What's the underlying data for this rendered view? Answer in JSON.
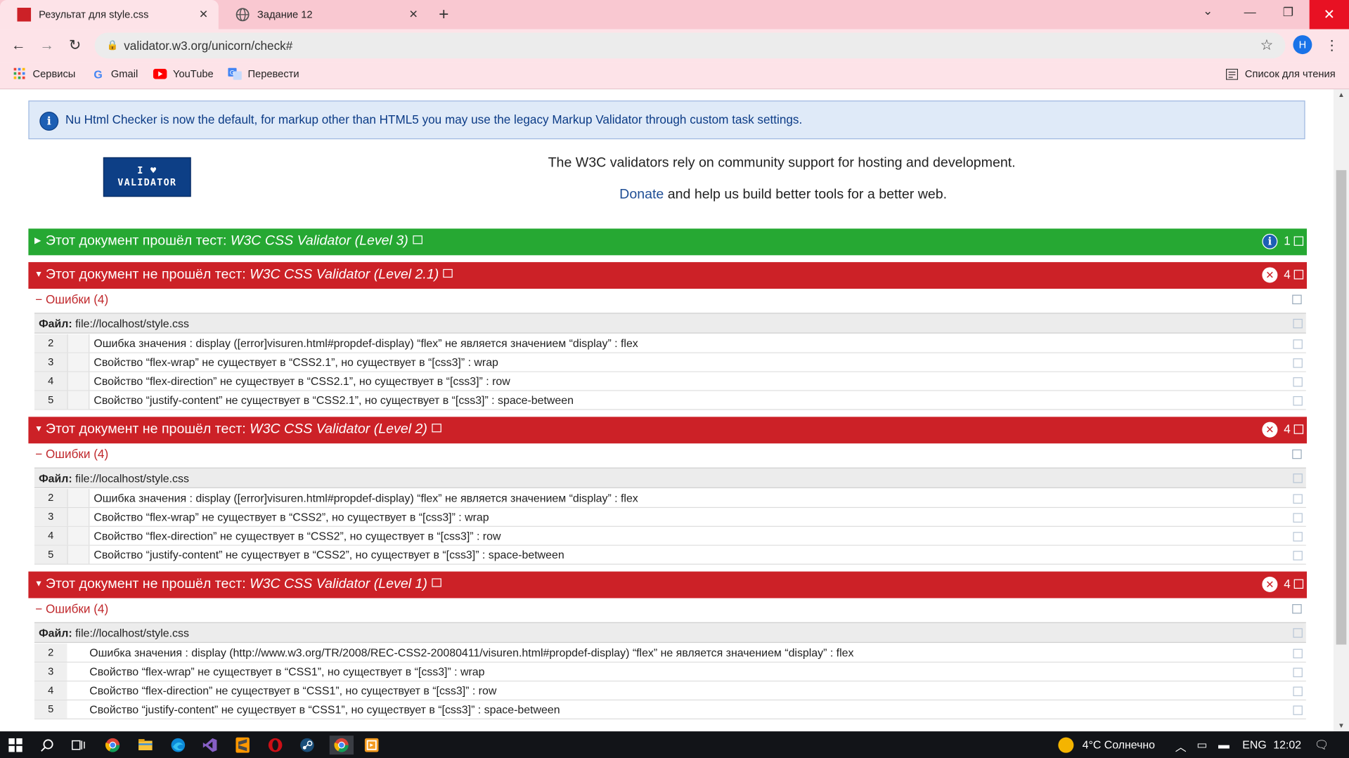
{
  "browser": {
    "tabs": [
      {
        "title": "Результат для style.css",
        "active": true,
        "close": "✕"
      },
      {
        "title": "Задание 12",
        "active": false,
        "close": "✕"
      }
    ],
    "new_tab": "+",
    "window_controls": {
      "minimize": "—",
      "restore": "❐",
      "close": "✕",
      "dropdown": "⌄"
    },
    "nav": {
      "back": "←",
      "forward": "→",
      "reload": "↻"
    },
    "url": "validator.w3.org/unicorn/check#",
    "profile_initial": "H",
    "bookmarks": [
      {
        "label": "Сервисы",
        "icon": "apps-grid-icon"
      },
      {
        "label": "Gmail",
        "icon": "google-g-icon"
      },
      {
        "label": "YouTube",
        "icon": "youtube-icon"
      },
      {
        "label": "Перевести",
        "icon": "translate-icon"
      }
    ],
    "reading_list": "Список для чтения",
    "colors": {
      "tab_strip": "#f9c8d1",
      "toolbar": "#fde3e8",
      "close_hover": "#e81123"
    }
  },
  "page": {
    "info_text": "Nu Html Checker is now the default, for markup other than HTML5 you may use the legacy Markup Validator through custom task settings.",
    "logo_lines": [
      "I ♥",
      "VALIDATOR"
    ],
    "support_line1": "The W3C validators rely on community support for hosting and development.",
    "donate_link": "Donate",
    "support_line2_rest": " and help us build better tools for a better web.",
    "colors": {
      "pass": "#26a833",
      "fail": "#cc2127",
      "info_bg": "#dfeaf8",
      "link": "#1f4e95"
    },
    "sections": [
      {
        "status": "pass",
        "prefix": "Этот документ прошёл тест: ",
        "validator": "W3C CSS Validator (Level 3)",
        "count": "1",
        "status_icon": "info-icon"
      },
      {
        "status": "fail",
        "prefix": "Этот документ не прошёл тест: ",
        "validator": "W3C CSS Validator (Level 2.1)",
        "count": "4",
        "status_icon": "error-icon",
        "errors_label": "− Ошибки (4)",
        "file_label": "Файл:",
        "file_path": " file://localhost/style.css",
        "rows": [
          {
            "line": "2",
            "message": "Ошибка значения : display ([error]visuren.html#propdef-display) “flex” не является значением “display” : flex"
          },
          {
            "line": "3",
            "message": "Свойство “flex-wrap” не существует в “CSS2.1”, но существует в “[css3]” : wrap"
          },
          {
            "line": "4",
            "message": "Свойство “flex-direction” не существует в “CSS2.1”, но существует в “[css3]” : row"
          },
          {
            "line": "5",
            "message": "Свойство “justify-content” не существует в “CSS2.1”, но существует в “[css3]” : space-between"
          }
        ]
      },
      {
        "status": "fail",
        "prefix": "Этот документ не прошёл тест: ",
        "validator": "W3C CSS Validator (Level 2)",
        "count": "4",
        "status_icon": "error-icon",
        "errors_label": "− Ошибки (4)",
        "file_label": "Файл:",
        "file_path": " file://localhost/style.css",
        "rows": [
          {
            "line": "2",
            "message": "Ошибка значения : display ([error]visuren.html#propdef-display) “flex” не является значением “display” : flex"
          },
          {
            "line": "3",
            "message": "Свойство “flex-wrap” не существует в “CSS2”, но существует в “[css3]” : wrap"
          },
          {
            "line": "4",
            "message": "Свойство “flex-direction” не существует в “CSS2”, но существует в “[css3]” : row"
          },
          {
            "line": "5",
            "message": "Свойство “justify-content” не существует в “CSS2”, но существует в “[css3]” : space-between"
          }
        ]
      },
      {
        "status": "fail",
        "prefix": "Этот документ не прошёл тест: ",
        "validator": "W3C CSS Validator (Level 1)",
        "count": "4",
        "status_icon": "error-icon",
        "errors_label": "− Ошибки (4)",
        "file_label": "Файл:",
        "file_path": " file://localhost/style.css",
        "rows": [
          {
            "line": "2",
            "message": "Ошибка значения : display (http://www.w3.org/TR/2008/REC-CSS2-20080411/visuren.html#propdef-display) “flex” не является значением “display” : flex"
          },
          {
            "line": "3",
            "message": "Свойство “flex-wrap” не существует в “CSS1”, но существует в “[css3]” : wrap"
          },
          {
            "line": "4",
            "message": "Свойство “flex-direction” не существует в “CSS1”, но существует в “[css3]” : row"
          },
          {
            "line": "5",
            "message": "Свойство “justify-content” не существует в “CSS1”, но существует в “[css3]” : space-between"
          }
        ]
      }
    ]
  },
  "taskbar": {
    "apps": [
      "windows-start-icon",
      "search-icon",
      "task-view-icon",
      "chrome-icon",
      "file-explorer-icon",
      "edge-icon",
      "visual-studio-icon",
      "sublime-text-icon",
      "opera-icon",
      "steam-icon",
      "chrome-active-icon",
      "app-orange-icon"
    ],
    "weather": "4°C  Солнечно",
    "language": "ENG",
    "time": "12:02"
  }
}
